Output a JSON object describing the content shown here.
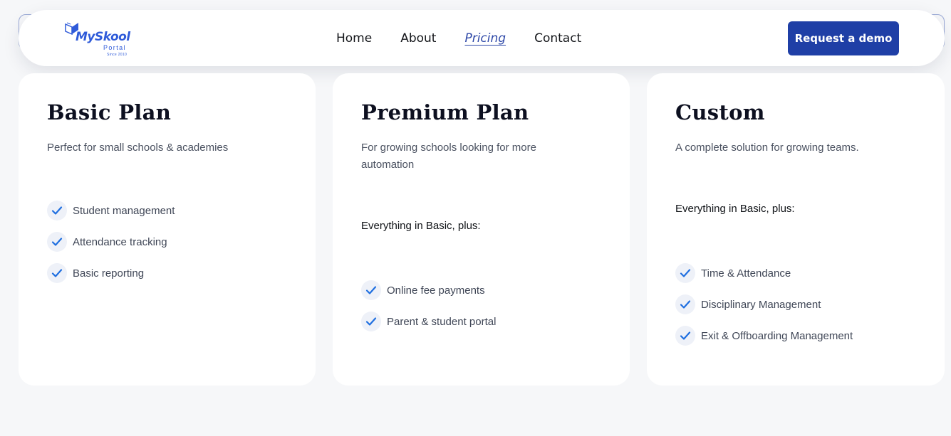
{
  "brand": {
    "name": "MySkool",
    "sub": "Portal",
    "since": "Since 2010"
  },
  "nav": {
    "items": [
      {
        "label": "Home",
        "active": false
      },
      {
        "label": "About",
        "active": false
      },
      {
        "label": "Pricing",
        "active": true
      },
      {
        "label": "Contact",
        "active": false
      }
    ],
    "cta_label": "Request a demo"
  },
  "plans": [
    {
      "title": "Basic Plan",
      "description": "Perfect for small schools & academies",
      "plus_label": "",
      "features": [
        "Student management",
        "Attendance tracking",
        "Basic reporting"
      ]
    },
    {
      "title": "Premium Plan",
      "description": "For growing schools looking for more automation",
      "plus_label": "Everything in Basic, plus:",
      "features": [
        "Online fee payments",
        "Parent & student portal"
      ]
    },
    {
      "title": "Custom",
      "description": "A complete solution for growing teams.",
      "plus_label": "Everything in Basic, plus:",
      "features": [
        "Time & Attendance",
        "Disciplinary Management",
        "Exit & Offboarding Management"
      ]
    }
  ],
  "colors": {
    "accent": "#1f3fa6",
    "brand": "#2f5bd9",
    "check": "#1f6fe0",
    "background": "#f6f7f9"
  }
}
